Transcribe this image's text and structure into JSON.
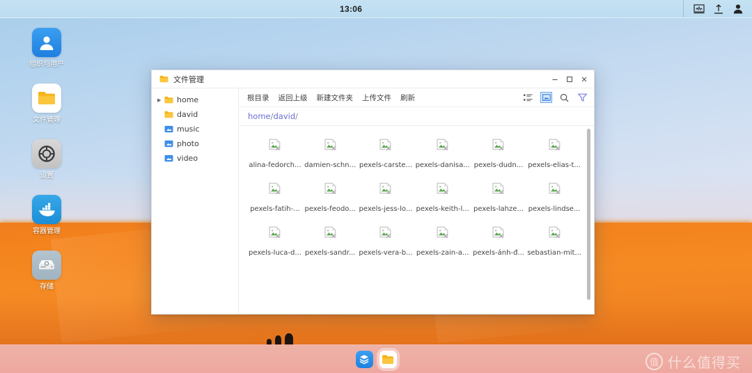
{
  "topbar": {
    "clock": "13:06",
    "tray": [
      {
        "name": "monitor-icon",
        "label": "monitor"
      },
      {
        "name": "upload-icon",
        "label": "upload"
      },
      {
        "name": "user-icon",
        "label": "user"
      }
    ]
  },
  "desktop": {
    "icons": [
      {
        "id": "users",
        "label": "组织与用户",
        "icon": "user-avatar-icon"
      },
      {
        "id": "files",
        "label": "文件管理",
        "icon": "folder-icon"
      },
      {
        "id": "settings",
        "label": "设置",
        "icon": "gear-icon"
      },
      {
        "id": "docker",
        "label": "容器管理",
        "icon": "docker-whale-icon"
      },
      {
        "id": "storage",
        "label": "存储",
        "icon": "hard-drive-icon"
      }
    ]
  },
  "window": {
    "title": "文件管理",
    "controls": {
      "minimize": "−",
      "maximize": "□",
      "close": "✕"
    },
    "sidebar": [
      {
        "label": "home",
        "type": "folder-yellow",
        "expandable": true,
        "indent": 0
      },
      {
        "label": "david",
        "type": "folder-yellow",
        "expandable": false,
        "indent": 1
      },
      {
        "label": "music",
        "type": "folder-blue",
        "expandable": false,
        "indent": 1
      },
      {
        "label": "photo",
        "type": "folder-blue",
        "expandable": false,
        "indent": 1
      },
      {
        "label": "video",
        "type": "folder-blue",
        "expandable": false,
        "indent": 1
      }
    ],
    "toolbar": {
      "buttons": [
        {
          "label": "根目录",
          "name": "root-directory-button"
        },
        {
          "label": "返回上级",
          "name": "go-up-button"
        },
        {
          "label": "新建文件夹",
          "name": "new-folder-button"
        },
        {
          "label": "上传文件",
          "name": "upload-file-button"
        },
        {
          "label": "刷新",
          "name": "refresh-button"
        }
      ],
      "view_list": "list-view-icon",
      "view_grid": "grid-view-icon",
      "view_grid_active": true,
      "search": "search-icon",
      "filter": "filter-icon"
    },
    "breadcrumb": {
      "parts": [
        "home",
        "david"
      ],
      "separator": "/",
      "trailing": "/",
      "full": "home/david/"
    },
    "files": [
      "alina-fedorch...",
      "damien-schn...",
      "pexels-carste...",
      "pexels-danisa...",
      "pexels-dudn...",
      "pexels-elias-t...",
      "pexels-fatih-...",
      "pexels-feodo...",
      "pexels-jess-lo...",
      "pexels-keith-l...",
      "pexels-lahze...",
      "pexels-lindse...",
      "pexels-luca-d...",
      "pexels-sandr...",
      "pexels-vera-b...",
      "pexels-zain-a...",
      "pexels-ánh-đ...",
      "sebastian-mit..."
    ],
    "file_thumb_icon": "broken-image-icon"
  },
  "taskbar": {
    "items": [
      {
        "name": "taskbar-layers-app",
        "icon": "layers-icon",
        "active": false
      },
      {
        "name": "taskbar-file-manager",
        "icon": "folder-icon",
        "active": true
      }
    ]
  },
  "watermark": {
    "badge": "值",
    "text": "什么值得买"
  },
  "colors": {
    "accent_blue": "#6b6fd4",
    "toolbar_active": "#6aa8e8",
    "folder_yellow": "#f5b317",
    "folder_blue": "#3d8ee8",
    "dune_orange": "#f4841d",
    "taskbar_pink": "#f2a69c"
  }
}
